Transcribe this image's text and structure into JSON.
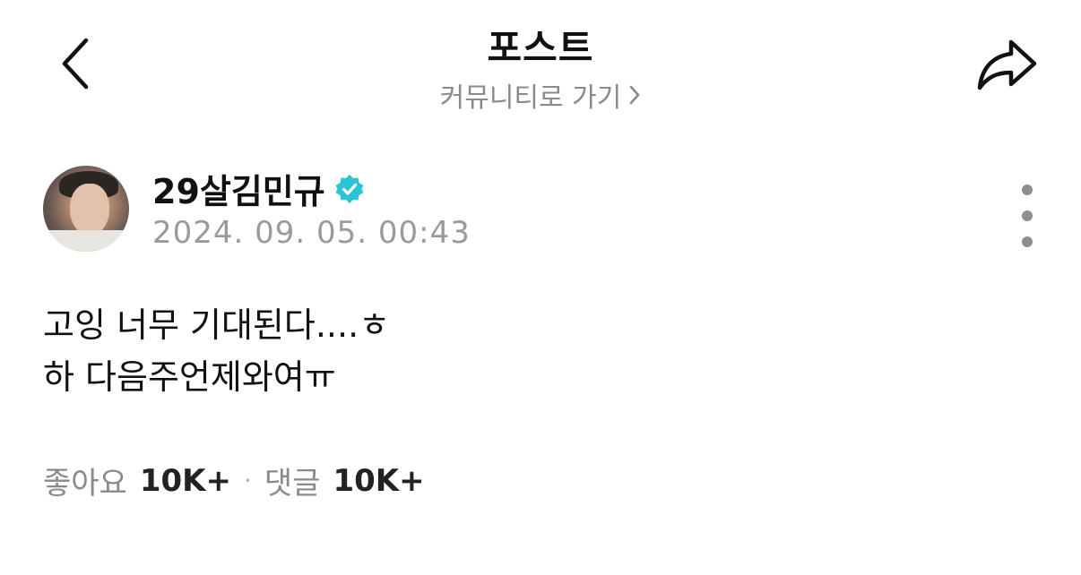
{
  "header": {
    "title": "포스트",
    "community_link": "커뮤니티로 가기",
    "back_icon": "chevron-left-icon",
    "share_icon": "share-arrow-icon"
  },
  "author": {
    "name": "29살김민규",
    "verified": true,
    "verified_color": "#2bc4d6",
    "timestamp": "2024. 09. 05. 00:43"
  },
  "post": {
    "lines": [
      "고잉 너무 기대된다....ㅎ",
      "하 다음주언제와여ㅠ"
    ]
  },
  "stats": {
    "likes_label": "좋아요",
    "likes_count": "10K+",
    "separator": "·",
    "comments_label": "댓글",
    "comments_count": "10K+"
  }
}
